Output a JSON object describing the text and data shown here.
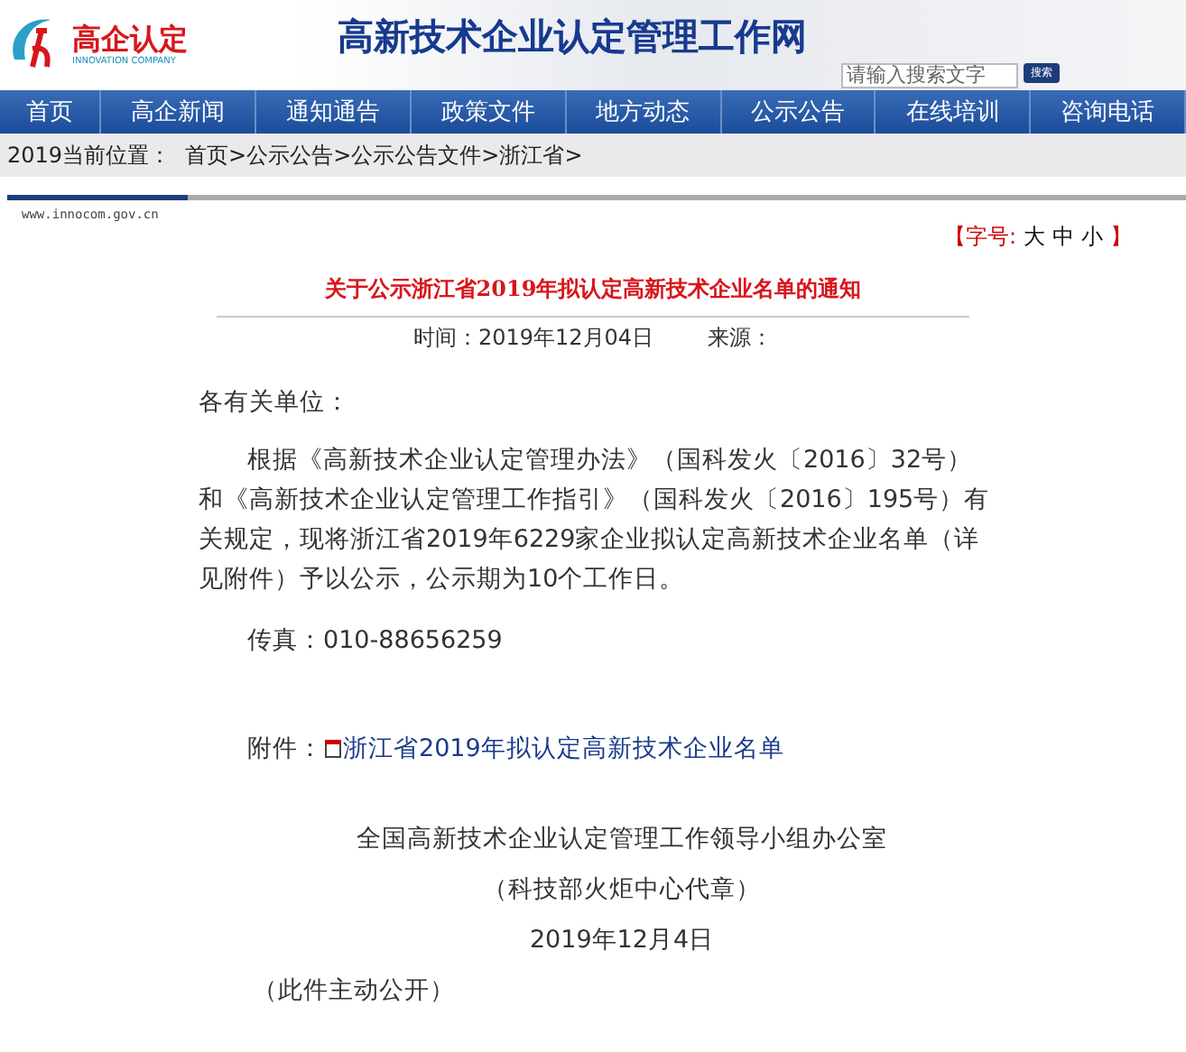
{
  "header": {
    "logo_text": "高企认定",
    "logo_subtext": "INNOVATION COMPANY",
    "site_title": "高新技术企业认定管理工作网",
    "search": {
      "placeholder": "请输入搜索文字"
    },
    "search_button": "搜索"
  },
  "nav": [
    {
      "label": "首页"
    },
    {
      "label": "高企新闻"
    },
    {
      "label": "通知通告"
    },
    {
      "label": "政策文件"
    },
    {
      "label": "地方动态"
    },
    {
      "label": "公示公告"
    },
    {
      "label": "在线培训"
    },
    {
      "label": "咨询电话"
    }
  ],
  "breadcrumb": {
    "prefix": "2019当前位置：",
    "items": [
      "首页>",
      "公示公告>",
      "公示公告文件>",
      "浙江省>"
    ]
  },
  "article": {
    "site_url": "www.innocom.gov.cn",
    "font_size": {
      "label": "【字号:",
      "options": [
        "大",
        "中",
        "小"
      ],
      "close": "】"
    },
    "title": "关于公示浙江省2019年拟认定高新技术企业名单的通知",
    "time": "时间：2019年12月04日",
    "source": "来源：",
    "greeting": "各有关单位：",
    "body": "根据《高新技术企业认定管理办法》（国科发火〔2016〕32号）和《高新技术企业认定管理工作指引》（国科发火〔2016〕195号）有关规定，现将浙江省2019年6229家企业拟认定高新技术企业名单（详见附件）予以公示，公示期为10个工作日。",
    "fax": "传真：010-88656259",
    "attachment_label": "附件：",
    "attachment_link": "浙江省2019年拟认定高新技术企业名单",
    "signature": [
      "全国高新技术企业认定管理工作领导小组办公室",
      "（科技部火炬中心代章）",
      "2019年12月4日"
    ],
    "note": "（此件主动公开）"
  }
}
